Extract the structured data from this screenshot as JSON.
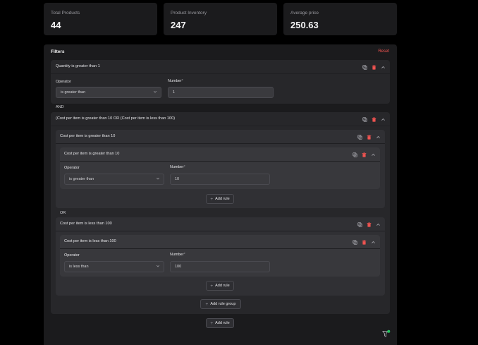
{
  "stats": [
    {
      "label": "Total Products",
      "value": "44"
    },
    {
      "label": "Product Inventory",
      "value": "247"
    },
    {
      "label": "Average price",
      "value": "250.63"
    }
  ],
  "filters": {
    "title": "Filters",
    "reset_label": "Reset",
    "rule_1": {
      "title": "Quantity is greater than 1",
      "operator_label": "Operator",
      "operator_value": "is greater than",
      "number_label": "Number",
      "number_required": "*",
      "number_value": "1"
    },
    "connector_and": "AND",
    "group": {
      "title": "(Cost per item is greater than 10 OR (Cost per item is less than 100)",
      "sub_a": {
        "title": "Cost per item is greater than 10",
        "rule": {
          "title": "Cost per item is greater than 10",
          "operator_label": "Operator",
          "operator_value": "is greater than",
          "number_label": "Number",
          "number_required": "*",
          "number_value": "10"
        },
        "add_rule_label": "Add rule"
      },
      "connector_or": "OR",
      "sub_b": {
        "title": "Cost per item is less than 100",
        "rule": {
          "title": "Cost per item is less than 100",
          "operator_label": "Operator",
          "operator_value": "is less than",
          "number_label": "Number",
          "number_required": "*",
          "number_value": "100"
        },
        "add_rule_label": "Add rule"
      },
      "add_rule_group_label": "Add rule group"
    },
    "add_rule_label": "Add rule"
  },
  "colors": {
    "page_bg": "#000000",
    "panel_bg": "#1b1b1d",
    "delete_icon": "#ef5350",
    "reset_text": "#ef5350",
    "badge": "#22c55e"
  },
  "icons": [
    "copy-icon",
    "trash-icon",
    "chevron-up-icon",
    "chevron-down-icon",
    "plus-icon",
    "filter-icon"
  ]
}
